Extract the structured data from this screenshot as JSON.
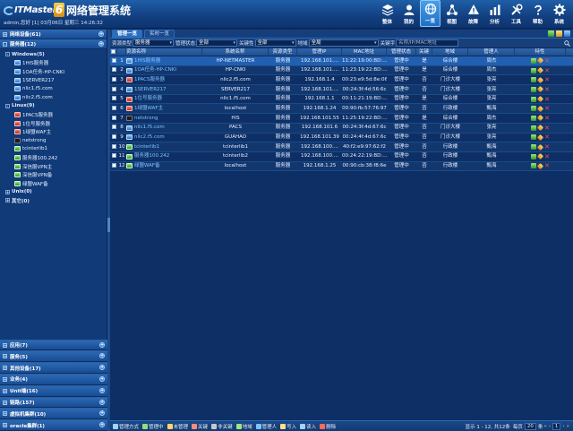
{
  "header": {
    "app_title": "网络管理系统",
    "logo_text": "ITMaster",
    "logo_number": "6",
    "user_info": "admin,您好 [1] 03月06日 星期三 14:26:32",
    "nav": [
      {
        "label": "整体",
        "icon": "layers-icon"
      },
      {
        "label": "我的",
        "icon": "user-icon"
      },
      {
        "label": "一览",
        "icon": "globe-icon",
        "active": true
      },
      {
        "label": "视图",
        "icon": "view-icon"
      },
      {
        "label": "故障",
        "icon": "fault-icon"
      },
      {
        "label": "分析",
        "icon": "analysis-icon"
      },
      {
        "label": "工具",
        "icon": "tools-icon"
      },
      {
        "label": "帮助",
        "icon": "help-icon"
      },
      {
        "label": "系统",
        "icon": "gear-icon"
      }
    ]
  },
  "sidebar": {
    "top_head": "网络设备(61)",
    "server_head": "服务器(12)",
    "tree": [
      {
        "label": "Windows(5)",
        "level": 1,
        "toggle": "-"
      },
      {
        "label": "1HIS服务器",
        "level": 2,
        "icon": "ic-host"
      },
      {
        "label": "1OA任务-HP-CNKI",
        "level": 2,
        "icon": "ic-host"
      },
      {
        "label": "1SERVER217",
        "level": 2,
        "icon": "ic-host"
      },
      {
        "label": "nlic1.f5.com",
        "level": 2,
        "icon": "ic-host"
      },
      {
        "label": "nlic2.f5.com",
        "level": 2,
        "icon": "ic-host"
      },
      {
        "label": "Linux(9)",
        "level": 1,
        "toggle": "-"
      },
      {
        "label": "1PACS服务器",
        "level": 2,
        "icon": "ic-dev"
      },
      {
        "label": "1住号服务器",
        "level": 2,
        "icon": "ic-dev"
      },
      {
        "label": "1绿盟WAF主",
        "level": 2,
        "icon": "ic-dev"
      },
      {
        "label": "netstrong",
        "level": 2,
        "icon": "ic-dark"
      },
      {
        "label": "tcinterlib1",
        "level": 2,
        "icon": "ic-ok"
      },
      {
        "label": "服务器100.242",
        "level": 2,
        "icon": "ic-ok"
      },
      {
        "label": "深信服VPN主",
        "level": 2,
        "icon": "ic-ok"
      },
      {
        "label": "深信服VPN备",
        "level": 2,
        "icon": "ic-ok"
      },
      {
        "label": "绿盟WAF备",
        "level": 2,
        "icon": "ic-ok"
      },
      {
        "label": "Unix(0)",
        "level": 1,
        "toggle": "+"
      },
      {
        "label": "其它(0)",
        "level": 1,
        "toggle": "+"
      }
    ],
    "bottom": [
      "应用(7)",
      "服务(5)",
      "其他设备(17)",
      "业务(4)",
      "Unit端(16)",
      "链路(157)",
      "虚拟机集群(10)",
      "oracle集群(1)"
    ]
  },
  "main": {
    "tabs": [
      "管理一览",
      "实时一览"
    ],
    "filters": {
      "type_label": "资源类型",
      "type_value": "服务器",
      "status_label": "管理状态",
      "status_value": "全部",
      "key_label": "关键性",
      "key_value": "全部",
      "loc_label": "地域",
      "loc_value": "全局",
      "kw_label": "关键字",
      "kw_placeholder": "名称/IP/MAC地址"
    },
    "columns": [
      "",
      "",
      "资源名称",
      "系统名称",
      "资源类型",
      "管理IP",
      "MAC地址",
      "管理状态",
      "关键",
      "地域",
      "管理人",
      "特性"
    ],
    "rows": [
      {
        "num": "1",
        "name": "1HIS服务器",
        "sys": "HP-NETMASTER",
        "type": "服务器",
        "ip": "192.168.101....",
        "mac": "11:22:19:00:BD:...",
        "status": "管理中",
        "key": "是",
        "loc": "综合楼",
        "owner": "周杰",
        "icon": "ic-host"
      },
      {
        "num": "2",
        "name": "1OA任务-HP-CNKI",
        "sys": "HP-CNKI",
        "type": "服务器",
        "ip": "192.168.101....",
        "mac": "11:23:19:22:BD:...",
        "status": "管理中",
        "key": "是",
        "loc": "综合楼",
        "owner": "周杰",
        "icon": "ic-host"
      },
      {
        "num": "3",
        "name": "1PACS服务器",
        "sys": "nlic2.f5.com",
        "type": "服务器",
        "ip": "192.168.1.4",
        "mac": "00:23:e9:5d:8e:06",
        "status": "管理中",
        "key": "否",
        "loc": "门诊大楼",
        "owner": "张亮",
        "icon": "ic-dev"
      },
      {
        "num": "4",
        "name": "1SERVER217",
        "sys": "SERVER217",
        "type": "服务器",
        "ip": "192.168.101....",
        "mac": "00:24:3f:4d:56:6c",
        "status": "管理中",
        "key": "否",
        "loc": "门诊大楼",
        "owner": "张亮",
        "icon": "ic-host"
      },
      {
        "num": "5",
        "name": "1住号服务器",
        "sys": "nlic1.f5.com",
        "type": "服务器",
        "ip": "192.168.1.1",
        "mac": "00:11:21:19:BD:...",
        "status": "管理中",
        "key": "是",
        "loc": "综合楼",
        "owner": "张亮",
        "icon": "ic-dev"
      },
      {
        "num": "6",
        "name": "1绿盟WAF主",
        "sys": "localhost",
        "type": "服务器",
        "ip": "192.168.1.24",
        "mac": "00:90:fb:57:76:97",
        "status": "管理中",
        "key": "否",
        "loc": "行政楼",
        "owner": "甄海",
        "icon": "ic-dev"
      },
      {
        "num": "7",
        "name": "netstrong",
        "sys": "HIS",
        "type": "服务器",
        "ip": "192.168.101.55",
        "mac": "11:25:19:22:BD:...",
        "status": "管理中",
        "key": "是",
        "loc": "综合楼",
        "owner": "周杰",
        "icon": "ic-dark"
      },
      {
        "num": "8",
        "name": "nlic1.f5.com",
        "sys": "PACS",
        "type": "服务器",
        "ip": "192.168.101.6",
        "mac": "00:24:3f:4d:67:6c",
        "status": "管理中",
        "key": "否",
        "loc": "门诊大楼",
        "owner": "张亮",
        "icon": "ic-host"
      },
      {
        "num": "9",
        "name": "nlic2.f5.com",
        "sys": "GUAHAO",
        "type": "服务器",
        "ip": "192.168.101.39",
        "mac": "00:24:4f:4d:67:6c",
        "status": "管理中",
        "key": "否",
        "loc": "门诊大楼",
        "owner": "张亮",
        "icon": "ic-host"
      },
      {
        "num": "10",
        "name": "tcinterlib1",
        "sys": "tcinterlib1",
        "type": "服务器",
        "ip": "192.168.100....",
        "mac": "40:f2:e9:97:62:f2",
        "status": "管理中",
        "key": "否",
        "loc": "行政楼",
        "owner": "甄海",
        "icon": "ic-ok"
      },
      {
        "num": "11",
        "name": "服务器100.242",
        "sys": "tcinterlib2",
        "type": "服务器",
        "ip": "192.168.100....",
        "mac": "00:24:22:19:BD:...",
        "status": "管理中",
        "key": "否",
        "loc": "行政楼",
        "owner": "甄海",
        "icon": "ic-ok"
      },
      {
        "num": "12",
        "name": "绿盟WAF备",
        "sys": "localhost",
        "type": "服务器",
        "ip": "192.168.1.25",
        "mac": "00:90:cb:38:f8:6e",
        "status": "管理中",
        "key": "否",
        "loc": "行政楼",
        "owner": "甄海",
        "icon": "ic-ok"
      }
    ],
    "footer": {
      "buttons": [
        "管理方式",
        "管理中",
        "未管理",
        "关键",
        "非关键",
        "地域",
        "管理人",
        "写入",
        "读入",
        "删除"
      ],
      "page_info": "显示 1 - 12, 共12条",
      "per_page_label": "每页",
      "per_page": "20",
      "per_page_unit": "条",
      "page": "1"
    }
  }
}
